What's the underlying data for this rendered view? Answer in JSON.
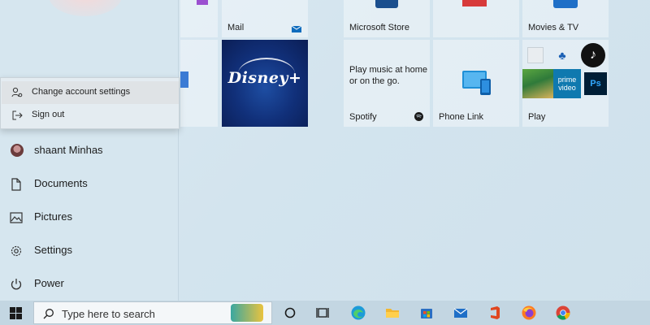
{
  "account_menu": {
    "items": [
      {
        "label": "Change account settings",
        "icon": "person-gear-icon"
      },
      {
        "label": "Sign out",
        "icon": "sign-out-icon"
      }
    ]
  },
  "left_pane": {
    "user_name": "shaant Minhas",
    "items": [
      {
        "label": "Documents",
        "icon": "document-icon"
      },
      {
        "label": "Pictures",
        "icon": "picture-icon"
      },
      {
        "label": "Settings",
        "icon": "gear-icon"
      },
      {
        "label": "Power",
        "icon": "power-icon"
      }
    ]
  },
  "tiles": {
    "mail": "Mail",
    "microsoft_store": "Microsoft Store",
    "movies_tv": "Movies & TV",
    "disney_plus": "Disney+",
    "spotify": "Spotify",
    "spotify_description": "Play music at home or on the go.",
    "phone_link": "Phone Link",
    "play": "Play",
    "prime_video": "prime video",
    "photoshop": "Ps"
  },
  "taskbar": {
    "search_placeholder": "Type here to search",
    "icons": [
      "windows-start-icon",
      "search-icon",
      "cortana-icon",
      "task-view-icon",
      "edge-icon",
      "file-explorer-icon",
      "store-icon",
      "mail-icon",
      "office-icon",
      "firefox-icon",
      "chrome-icon"
    ]
  },
  "colors": {
    "background": "#d3e4ee",
    "tile_overlay": "rgba(255,255,255,0.38)",
    "disney_blue": "#11307a",
    "taskbar": "#c3d6e2",
    "accent_blue": "#0f6cbd"
  }
}
